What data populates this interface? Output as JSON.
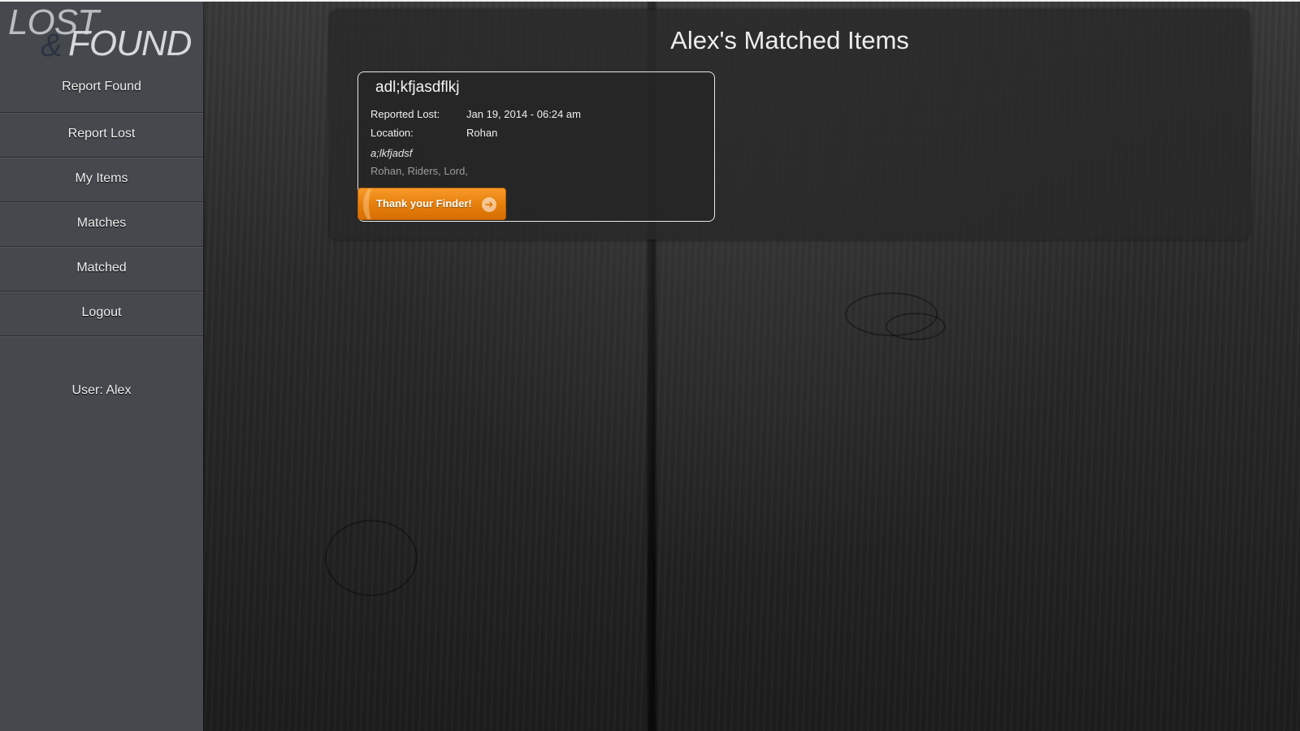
{
  "brand": {
    "logo_top": "LOST",
    "logo_amp": "&",
    "logo_bottom": "FOUND"
  },
  "sidebar": {
    "items": [
      {
        "label": "Report Found"
      },
      {
        "label": "Report Lost"
      },
      {
        "label": "My Items"
      },
      {
        "label": "Matches"
      },
      {
        "label": "Matched"
      },
      {
        "label": "Logout"
      }
    ],
    "user_label": "User: Alex"
  },
  "main": {
    "title": "Alex's Matched Items",
    "items": [
      {
        "name": "adl;kfjasdflkj",
        "reported_label": "Reported Lost:",
        "reported_value": "Jan 19, 2014 - 06:24 am",
        "location_label": "Location:",
        "location_value": "Rohan",
        "description": "a;lkfjadsf",
        "tags": "Rohan, Riders, Lord,",
        "action_label": "Thank your Finder!",
        "action_icon": "arrow-right-circle-icon"
      }
    ]
  },
  "colors": {
    "sidebar_bg": "#45484c",
    "accent_orange": "#e57e0a",
    "panel_bg": "#282828"
  }
}
